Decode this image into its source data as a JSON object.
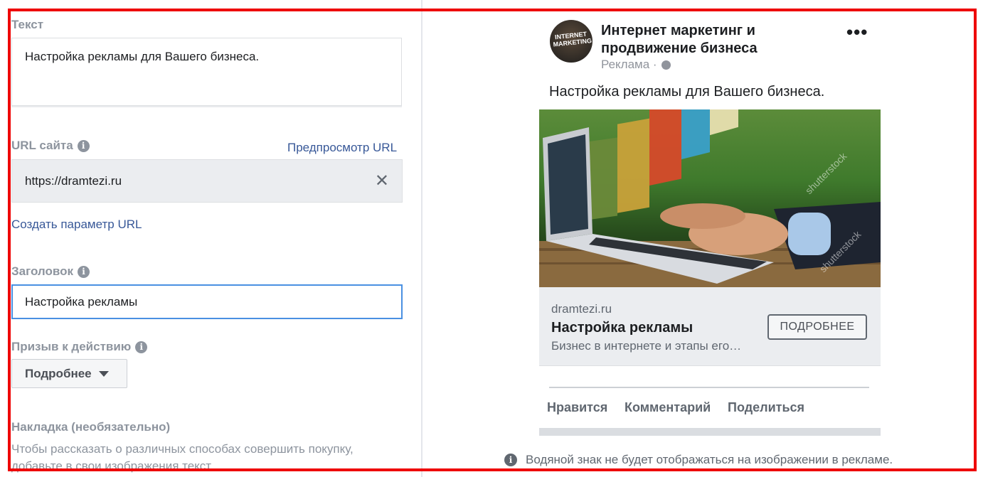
{
  "form": {
    "text_label": "Текст",
    "text_value": "Настройка рекламы для Вашего бизнеса.",
    "url_label": "URL сайта",
    "url_preview_link": "Предпросмотр URL",
    "url_value": "https://dramtezi.ru",
    "create_param_link": "Создать параметр URL",
    "headline_label": "Заголовок",
    "headline_value": "Настройка рекламы",
    "cta_label": "Призыв к действию",
    "cta_value": "Подробнее",
    "overlay_title": "Накладка (необязательно)",
    "overlay_desc": "Чтобы рассказать о различных способах совершить покупку, добавьте в свои изображения текст."
  },
  "preview": {
    "avatar_text": "INTERNET MARKETING",
    "page_name": "Интернет маркетинг и продвижение бизнеса",
    "sponsored": "Реклама ·",
    "post_text": "Настройка рекламы для Вашего бизнеса.",
    "image_watermark_text": "shutterstock",
    "card_domain": "dramtezi.ru",
    "card_headline": "Настройка рекламы",
    "card_desc": "Бизнес в интернете и этапы его…",
    "card_cta": "ПОДРОБНЕЕ",
    "actions": {
      "like": "Нравится",
      "comment": "Комментарий",
      "share": "Поделиться"
    },
    "note": "Водяной знак не будет отображаться на изображении в рекламе."
  },
  "colors": {
    "highlight_frame": "#ee0000",
    "link": "#385898",
    "focus_border": "#4a90e2"
  }
}
